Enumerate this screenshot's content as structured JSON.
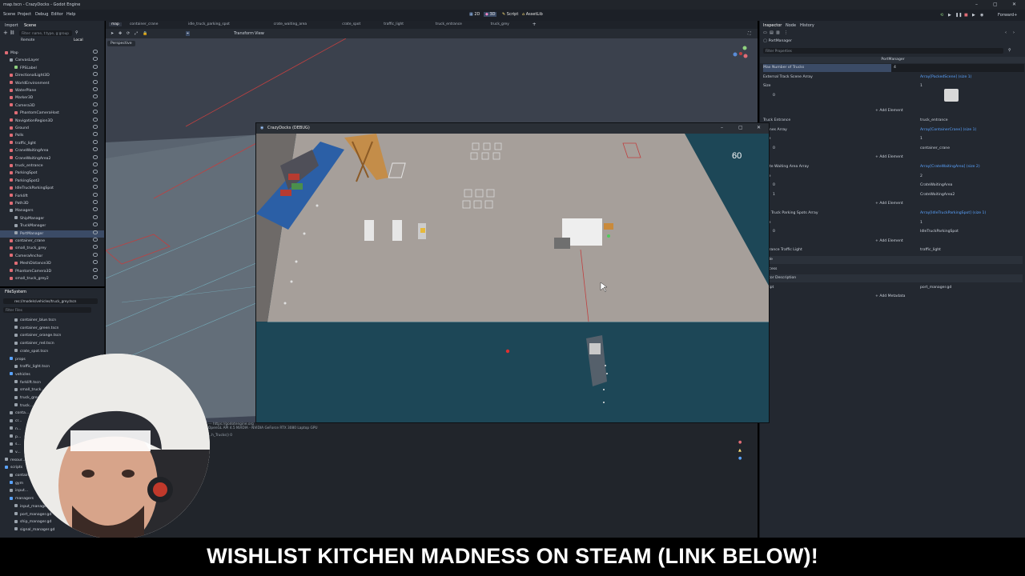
{
  "window": {
    "title": "map.tscn - CrazyDocks - Godot Engine"
  },
  "menu": {
    "items": [
      "Scene",
      "Project",
      "Debug",
      "Editor",
      "Help"
    ]
  },
  "workspaces": {
    "items": [
      "2D",
      "3D",
      "Script",
      "AssetLib"
    ]
  },
  "scene_dock": {
    "tabs": [
      "Import",
      "Scene"
    ],
    "filter_placeholder": "Filter: name, t:type, g:group",
    "remote_label": "Remote",
    "local_label": "Local",
    "tree": [
      {
        "label": "Map",
        "indent": 0,
        "color": "#e06c75"
      },
      {
        "label": "CanvasLayer",
        "indent": 1,
        "color": "#9aa3ad"
      },
      {
        "label": "FPSLabel",
        "indent": 2,
        "color": "#8fd17f"
      },
      {
        "label": "DirectionalLight3D",
        "indent": 1,
        "color": "#e06c75"
      },
      {
        "label": "WorldEnvironment",
        "indent": 1,
        "color": "#e06c75"
      },
      {
        "label": "WaterPlane",
        "indent": 1,
        "color": "#e06c75"
      },
      {
        "label": "Marker3D",
        "indent": 1,
        "color": "#e06c75"
      },
      {
        "label": "Camera3D",
        "indent": 1,
        "color": "#e06c75"
      },
      {
        "label": "PhantomCameraHost",
        "indent": 2,
        "color": "#e06c75"
      },
      {
        "label": "NavigationRegion3D",
        "indent": 1,
        "color": "#e06c75"
      },
      {
        "label": "Ground",
        "indent": 1,
        "color": "#e06c75"
      },
      {
        "label": "Polls",
        "indent": 1,
        "color": "#e06c75"
      },
      {
        "label": "traffic_light",
        "indent": 1,
        "color": "#e06c75"
      },
      {
        "label": "CraneWaitingArea",
        "indent": 1,
        "color": "#e06c75"
      },
      {
        "label": "CraneWaitingArea2",
        "indent": 1,
        "color": "#e06c75"
      },
      {
        "label": "truck_entrance",
        "indent": 1,
        "color": "#e06c75"
      },
      {
        "label": "ParkingSpot",
        "indent": 1,
        "color": "#e06c75"
      },
      {
        "label": "ParkingSpot2",
        "indent": 1,
        "color": "#e06c75"
      },
      {
        "label": "IdleTruckParkingSpot",
        "indent": 1,
        "color": "#e06c75"
      },
      {
        "label": "Forklift",
        "indent": 1,
        "color": "#e06c75"
      },
      {
        "label": "Path3D",
        "indent": 1,
        "color": "#e06c75"
      },
      {
        "label": "Managers",
        "indent": 1,
        "color": "#9aa3ad"
      },
      {
        "label": "ShipManager",
        "indent": 2,
        "color": "#9aa3ad"
      },
      {
        "label": "TruckManager",
        "indent": 2,
        "color": "#9aa3ad"
      },
      {
        "label": "PortManager",
        "indent": 2,
        "color": "#9aa3ad"
      },
      {
        "label": "container_crane",
        "indent": 1,
        "color": "#e06c75"
      },
      {
        "label": "small_truck_grey",
        "indent": 1,
        "color": "#e06c75"
      },
      {
        "label": "CameraAnchor",
        "indent": 1,
        "color": "#e06c75"
      },
      {
        "label": "MeshDistance3D",
        "indent": 2,
        "color": "#e06c75"
      },
      {
        "label": "PhantomCamera3D",
        "indent": 1,
        "color": "#e06c75"
      },
      {
        "label": "small_truck_grey2",
        "indent": 1,
        "color": "#e06c75"
      }
    ],
    "selected_index": 24
  },
  "fs_dock": {
    "tab": "FileSystem",
    "path": "res://models/vehicles/truck_grey.tscn",
    "filter_placeholder": "Filter Files",
    "files": [
      {
        "label": "container_blue.tscn",
        "indent": 2
      },
      {
        "label": "container_green.tscn",
        "indent": 2
      },
      {
        "label": "container_orange.tscn",
        "indent": 2
      },
      {
        "label": "container_red.tscn",
        "indent": 2
      },
      {
        "label": "crate_spot.tscn",
        "indent": 2
      },
      {
        "label": "props",
        "indent": 1
      },
      {
        "label": "traffic_light.tscn",
        "indent": 2
      },
      {
        "label": "vehicles",
        "indent": 1
      },
      {
        "label": "forklift.tscn",
        "indent": 2
      },
      {
        "label": "small_truck...",
        "indent": 2
      },
      {
        "label": "truck_grey...",
        "indent": 2
      },
      {
        "label": "truck...",
        "indent": 2
      },
      {
        "label": "conta...",
        "indent": 1
      },
      {
        "label": "cr...",
        "indent": 1
      },
      {
        "label": "n...",
        "indent": 1
      },
      {
        "label": "p...",
        "indent": 1
      },
      {
        "label": "s...",
        "indent": 1
      },
      {
        "label": "v...",
        "indent": 1
      },
      {
        "label": "resour...",
        "indent": 0
      },
      {
        "label": "scripts",
        "indent": 0
      },
      {
        "label": "container...",
        "indent": 1
      },
      {
        "label": "gym",
        "indent": 1
      },
      {
        "label": "input...",
        "indent": 1
      },
      {
        "label": "managers",
        "indent": 1
      },
      {
        "label": "input_manager.gd",
        "indent": 2
      },
      {
        "label": "port_manager.gd",
        "indent": 2
      },
      {
        "label": "ship_manager.gd",
        "indent": 2
      },
      {
        "label": "signal_manager.gd",
        "indent": 2
      }
    ]
  },
  "editor": {
    "tabs": [
      "map",
      "container_crane",
      "idle_truck_parking_spot",
      "crate_waiting_area",
      "crate_spot",
      "traffic_light",
      "truck_entrance",
      "truck_grey"
    ],
    "toolbar_menus": [
      "Transform",
      "View"
    ],
    "view_label": "Perspective",
    "output_lines": [
      "--- https://godotengine.org",
      "OpenGL API 4.5 NVIDIA - NVIDIA GeForce RTX 3080 Laptop GPU",
      "...h_Trucks() 0"
    ]
  },
  "game": {
    "title": "CrazyDocks (DEBUG)",
    "fps": "60",
    "colors": {
      "ground": "#a69f9a",
      "water": "#1d4757",
      "ship_blue": "#2b5fa6",
      "crane": "#c98a3b"
    }
  },
  "inspector": {
    "tabs": [
      "Inspector",
      "Node",
      "History"
    ],
    "node_name": "PortManager",
    "filter_placeholder": "Filter Properties",
    "class_header": "PortManager",
    "rows": [
      {
        "label": "Max Number of Trucks",
        "value": "4",
        "kind": "field"
      },
      {
        "label": "External Track Scene Array",
        "value": "Array[PackedScene] (size 1)",
        "kind": "link"
      },
      {
        "label": "Size",
        "value": "1",
        "kind": "plain"
      },
      {
        "label": "0",
        "value": "",
        "kind": "thumb"
      },
      {
        "label": "",
        "value": "Add Element",
        "kind": "button"
      },
      {
        "label": "Truck Entrance",
        "value": "truck_entrance",
        "kind": "plain"
      },
      {
        "label": "Cranes Array",
        "value": "Array[ContainerCrane] (size 1)",
        "kind": "link"
      },
      {
        "label": "Size",
        "value": "1",
        "kind": "plain"
      },
      {
        "label": "0",
        "value": "container_crane",
        "kind": "plain"
      },
      {
        "label": "",
        "value": "Add Element",
        "kind": "button"
      },
      {
        "label": "Crate Waiting Area Array",
        "value": "Array[CrateWaitingArea] (size 2)",
        "kind": "link"
      },
      {
        "label": "Size",
        "value": "2",
        "kind": "plain"
      },
      {
        "label": "0",
        "value": "CrateWaitingArea",
        "kind": "plain"
      },
      {
        "label": "1",
        "value": "CrateWaitingArea2",
        "kind": "plain"
      },
      {
        "label": "",
        "value": "Add Element",
        "kind": "button"
      },
      {
        "label": "Idle Truck Parking Spots Array",
        "value": "Array[IdleTruckParkingSpot] (size 1)",
        "kind": "link"
      },
      {
        "label": "Size",
        "value": "1",
        "kind": "plain"
      },
      {
        "label": "0",
        "value": "IdleTruckParkingSpot",
        "kind": "plain"
      },
      {
        "label": "",
        "value": "Add Element",
        "kind": "button"
      },
      {
        "label": "Entrance Traffic Light",
        "value": "traffic_light",
        "kind": "plain"
      },
      {
        "label": "Node",
        "value": "",
        "kind": "section"
      },
      {
        "label": "Process",
        "value": "",
        "kind": "plain"
      },
      {
        "label": "Editor Description",
        "value": "",
        "kind": "section"
      },
      {
        "label": "Script",
        "value": "port_manager.gd",
        "kind": "plain"
      },
      {
        "label": "",
        "value": "Add Metadata",
        "kind": "button"
      }
    ]
  },
  "banner": {
    "text": "WISHLIST KITCHEN MADNESS ON STEAM (LINK BELOW)!"
  }
}
